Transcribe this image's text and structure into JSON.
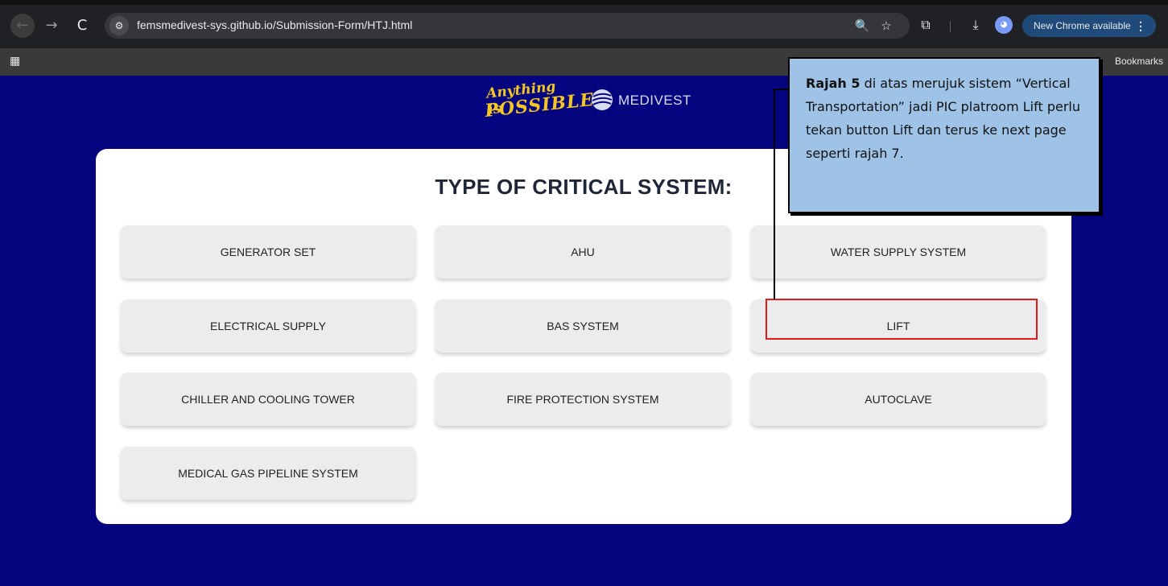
{
  "browser": {
    "url": "femsmedivest-sys.github.io/Submission-Form/HTJ.html",
    "update_label": "New Chrome available",
    "update_menu": "⋮",
    "bookmarks_label": "Bookmarks",
    "icons": {
      "back": "←",
      "forward": "→",
      "reload": "C",
      "site_info": "⚙",
      "zoom": "🔍",
      "star": "☆",
      "extensions": "⧉",
      "download": "⤓",
      "apps": "▦",
      "profile": "◕"
    }
  },
  "logos": {
    "anything_line1": "Anything is",
    "anything_line2": "POSSIBLE",
    "medivest": "MEDIVEST"
  },
  "card": {
    "title": "TYPE OF CRITICAL SYSTEM:",
    "buttons": [
      "GENERATOR SET",
      "AHU",
      "WATER SUPPLY SYSTEM",
      "ELECTRICAL SUPPLY",
      "BAS SYSTEM",
      "LIFT",
      "CHILLER AND COOLING TOWER",
      "FIRE PROTECTION SYSTEM",
      "AUTOCLAVE",
      "MEDICAL GAS PIPELINE SYSTEM"
    ]
  },
  "annotation": {
    "bold": "Rajah 5",
    "text": " di atas merujuk  sistem “Vertical Transportation” jadi PIC platroom Lift perlu tekan button Lift dan terus ke next page seperti rajah 7.",
    "highlight_color": "#e11b1b",
    "callout_bg": "#9ec3e6"
  },
  "colors": {
    "page_bg": "#05057f",
    "card_bg": "#ffffff",
    "button_bg": "#ececec",
    "chrome_bg": "#202124"
  }
}
